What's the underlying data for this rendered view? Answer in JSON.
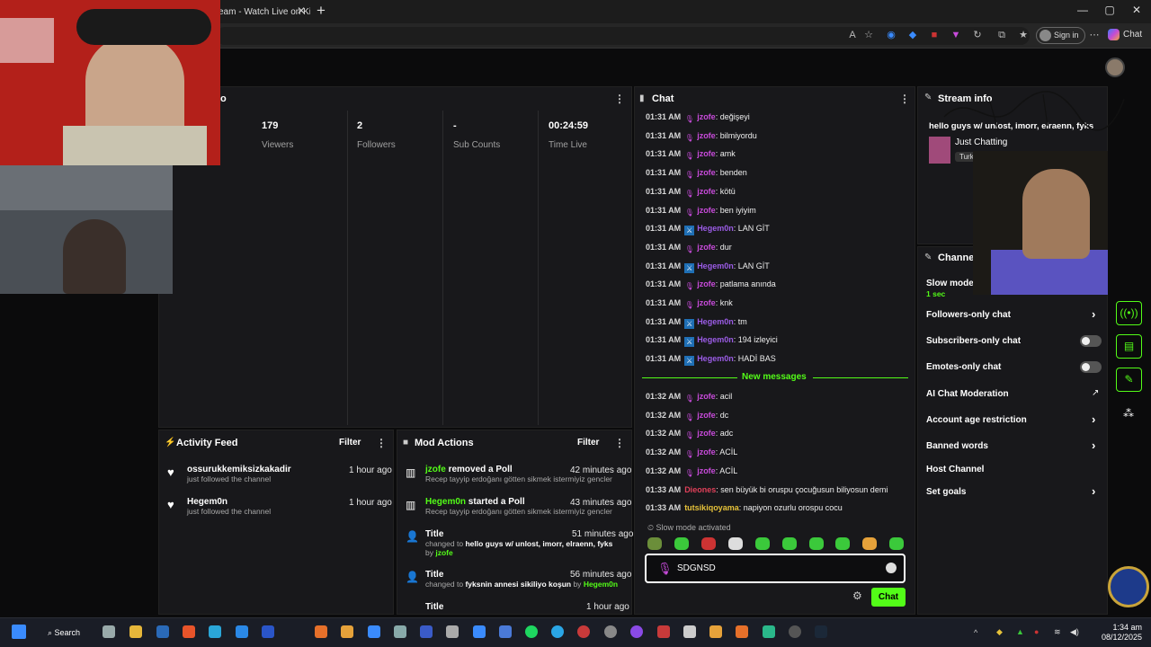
{
  "browser": {
    "tab_title": "eam - Watch Live on Ki",
    "sign_in": "Sign in",
    "chat_button": "Chat"
  },
  "stream_stats": [
    {
      "value": "179",
      "label": "Viewers"
    },
    {
      "value": "2",
      "label": "Followers"
    },
    {
      "value": "-",
      "label": "Sub Counts"
    },
    {
      "value": "00:24:59",
      "label": "Time Live"
    }
  ],
  "stream_info_header_partial": "o",
  "chat": {
    "title": "Chat",
    "messages": [
      {
        "time": "01:31 AM",
        "user": "jzofe",
        "badge": "mic",
        "text": ": değişeyi"
      },
      {
        "time": "01:31 AM",
        "user": "jzofe",
        "badge": "mic",
        "text": ": bilmiyordu"
      },
      {
        "time": "01:31 AM",
        "user": "jzofe",
        "badge": "mic",
        "text": ": amk"
      },
      {
        "time": "01:31 AM",
        "user": "jzofe",
        "badge": "mic",
        "text": ": benden"
      },
      {
        "time": "01:31 AM",
        "user": "jzofe",
        "badge": "mic",
        "text": ": kötü"
      },
      {
        "time": "01:31 AM",
        "user": "jzofe",
        "badge": "mic",
        "text": ": ben iyiyim"
      },
      {
        "time": "01:31 AM",
        "user": "Hegem0n",
        "badge": "mod",
        "text": ": LAN GİT"
      },
      {
        "time": "01:31 AM",
        "user": "jzofe",
        "badge": "mic",
        "text": ": dur"
      },
      {
        "time": "01:31 AM",
        "user": "Hegem0n",
        "badge": "mod",
        "text": ": LAN GİT"
      },
      {
        "time": "01:31 AM",
        "user": "jzofe",
        "badge": "mic",
        "text": ": patlama anında"
      },
      {
        "time": "01:31 AM",
        "user": "jzofe",
        "badge": "mic",
        "text": ": knk"
      },
      {
        "time": "01:31 AM",
        "user": "Hegem0n",
        "badge": "mod",
        "text": ": tm"
      },
      {
        "time": "01:31 AM",
        "user": "Hegem0n",
        "badge": "mod",
        "text": ": 194 izleyici"
      },
      {
        "time": "01:31 AM",
        "user": "Hegem0n",
        "badge": "mod",
        "text": ": HADİ BAS"
      }
    ],
    "new_messages_label": "New messages",
    "new_messages": [
      {
        "time": "01:32 AM",
        "user": "jzofe",
        "badge": "mic",
        "text": ": acil"
      },
      {
        "time": "01:32 AM",
        "user": "jzofe",
        "badge": "mic",
        "text": ": dc"
      },
      {
        "time": "01:32 AM",
        "user": "jzofe",
        "badge": "mic",
        "text": ": adc"
      },
      {
        "time": "01:32 AM",
        "user": "jzofe",
        "badge": "mic",
        "text": ": ACİL"
      },
      {
        "time": "01:32 AM",
        "user": "jzofe",
        "badge": "mic",
        "text": ": ACİL"
      },
      {
        "time": "01:33 AM",
        "user": "Dieones",
        "badge": "",
        "text": ": sen büyük bi oruspu çocuğusun biliyosun demi"
      },
      {
        "time": "01:33 AM",
        "user": "tutsikiqoyama",
        "badge": "",
        "text": ": napiyon ozurlu orospu cocu"
      }
    ],
    "slow_mode": "Slow mode activated",
    "input_value": "SDGNSD",
    "send_label": "Chat"
  },
  "stream_info_panel": {
    "title": "Stream info",
    "stream_title": "hello guys w/ unlost, imorr, elraenn, fyks",
    "category": "Just Chatting",
    "tag": "Turk"
  },
  "channel_panel": {
    "title": "Channel",
    "slow_mode_label": "Slow mode",
    "slow_mode_value": "1 sec",
    "rows": [
      {
        "label": "Followers-only chat",
        "control": "chevron"
      },
      {
        "label": "Subscribers-only chat",
        "control": "toggle"
      },
      {
        "label": "Emotes-only chat",
        "control": "toggle"
      },
      {
        "label": "AI Chat Moderation",
        "control": "external"
      },
      {
        "label": "Account age restriction",
        "control": "chevron"
      },
      {
        "label": "Banned words",
        "control": "chevron"
      },
      {
        "label": "Host Channel",
        "control": "none"
      },
      {
        "label": "Set goals",
        "control": "chevron"
      }
    ]
  },
  "activity_feed": {
    "title": "Activity Feed",
    "filter": "Filter",
    "items": [
      {
        "user": "ossurukkemiksizkakadir",
        "action": "just followed the channel",
        "time": "1 hour ago"
      },
      {
        "user": "Hegem0n",
        "action": "just followed the channel",
        "time": "1 hour ago"
      }
    ]
  },
  "mod_actions": {
    "title": "Mod Actions",
    "filter": "Filter",
    "items": [
      {
        "actor": "jzofe",
        "verb": "removed a Poll",
        "detail": "Recep tayyip erdoğanı götten sikmek istermiyiz gencler",
        "time": "42 minutes ago"
      },
      {
        "actor": "Hegem0n",
        "verb": "started a Poll",
        "detail": "Recep tayyip erdoğanı götten sikmek istermiyiz gencler",
        "time": "43 minutes ago"
      },
      {
        "heading": "Title",
        "changed_prefix": "changed to",
        "changed_to": "hello guys w/ unlost, imorr, elraenn, fyks",
        "by": "by",
        "actor": "jzofe",
        "time": "51 minutes ago"
      },
      {
        "heading": "Title",
        "changed_prefix": "changed to",
        "changed_to": "fyksnin annesi sikiliyo koşun",
        "by": "by",
        "actor": "Hegem0n",
        "time": "56 minutes ago"
      },
      {
        "heading": "Title",
        "time": "1 hour ago"
      }
    ]
  },
  "taskbar": {
    "search": "Search",
    "time": "1:34 am",
    "date": "08/12/2025"
  },
  "colors": {
    "accent": "#53fc18",
    "mic_user": "#c84bdb",
    "mod_user": "#9b5ce6",
    "panel": "#18181b"
  }
}
